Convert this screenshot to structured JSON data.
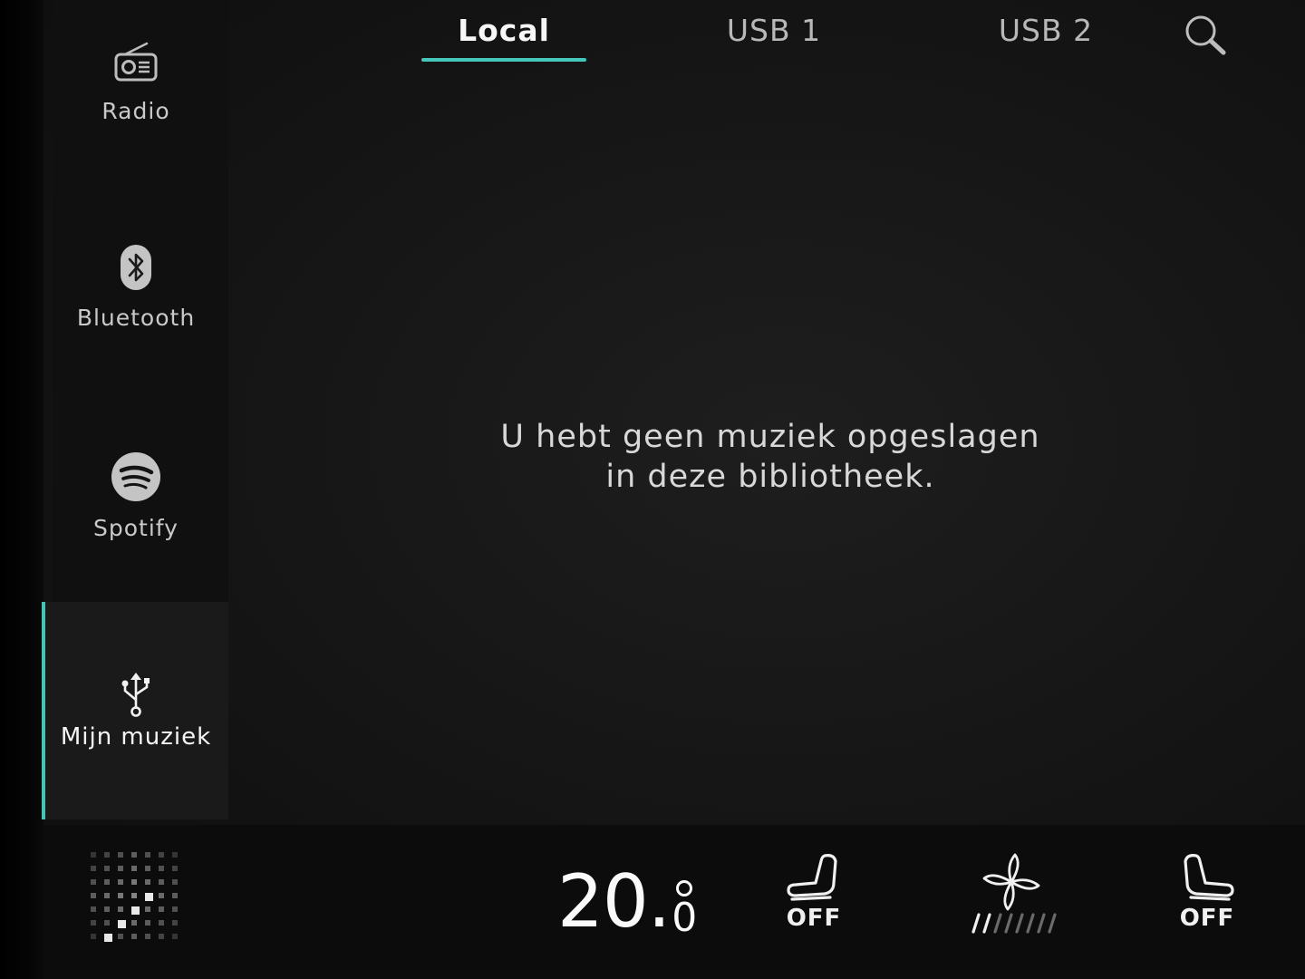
{
  "sidebar": {
    "items": [
      {
        "id": "radio",
        "label": "Radio",
        "icon": "radio-icon"
      },
      {
        "id": "bluetooth",
        "label": "Bluetooth",
        "icon": "bluetooth-icon"
      },
      {
        "id": "spotify",
        "label": "Spotify",
        "icon": "spotify-icon"
      },
      {
        "id": "mymusic",
        "label": "Mijn muziek",
        "icon": "usb-icon",
        "active": true
      }
    ]
  },
  "tabs": [
    {
      "label": "Local",
      "active": true
    },
    {
      "label": "USB 1",
      "active": false
    },
    {
      "label": "USB 2",
      "active": false
    }
  ],
  "search": {
    "icon": "search-icon"
  },
  "main": {
    "empty_line1": "U hebt geen muziek opgeslagen",
    "empty_line2": "in deze bibliotheek."
  },
  "climate": {
    "temperature_int": "20.",
    "temperature_dec": "0",
    "seat_left_state": "OFF",
    "seat_right_state": "OFF",
    "fan_level": 0.28,
    "fan_icon": "fan-icon",
    "seat_icon": "seat-heat-icon"
  },
  "colors": {
    "accent": "#45c8bb",
    "background": "#161616",
    "text": "#d8d8d8"
  }
}
